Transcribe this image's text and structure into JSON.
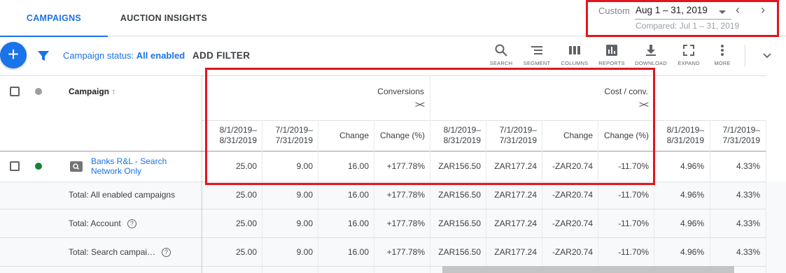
{
  "tabs": [
    {
      "label": "CAMPAIGNS",
      "active": true
    },
    {
      "label": "AUCTION INSIGHTS",
      "active": false
    }
  ],
  "date_range": {
    "custom_label": "Custom",
    "value": "Aug 1 – 31, 2019",
    "compared": "Compared: Jul 1 – 31, 2019",
    "prev_icon": "chevron-left-icon",
    "next_icon": "chevron-right-icon"
  },
  "toolbar": {
    "add_icon": "plus-icon",
    "filter_icon": "filter-icon",
    "status_prefix": "Campaign status:",
    "status_value": "All enabled",
    "add_filter": "ADD FILTER",
    "tools": [
      {
        "label": "SEARCH",
        "icon": "search-icon"
      },
      {
        "label": "SEGMENT",
        "icon": "segment-icon"
      },
      {
        "label": "COLUMNS",
        "icon": "columns-icon"
      },
      {
        "label": "REPORTS",
        "icon": "reports-icon"
      },
      {
        "label": "DOWNLOAD",
        "icon": "download-icon"
      },
      {
        "label": "EXPAND",
        "icon": "expand-icon"
      },
      {
        "label": "MORE",
        "icon": "more-vert-icon"
      }
    ]
  },
  "table": {
    "campaign_header": "Campaign",
    "groups": [
      {
        "label": "Conversions",
        "toggle": "><"
      },
      {
        "label": "Cost / conv.",
        "toggle": "><"
      }
    ],
    "subheaders": [
      "8/1/2019–\n8/31/2019",
      "7/1/2019–\n7/31/2019",
      "Change",
      "Change (%)",
      "8/1/2019–\n8/31/2019",
      "7/1/2019–\n7/31/2019",
      "Change",
      "Change (%)",
      "8/1/2019–\n8/31/2019",
      "7/1/2019–\n7/31/2019"
    ],
    "campaign_row": {
      "name": "Banks R&L - Search Network Only",
      "status_color": "#188038",
      "values": [
        "25.00",
        "9.00",
        "16.00",
        "+177.78%",
        "ZAR156.50",
        "ZAR177.24",
        "-ZAR20.74",
        "-11.70%",
        "4.96%",
        "4.33%"
      ]
    },
    "totals": [
      {
        "label": "Total: All enabled campaigns",
        "help": false,
        "values": [
          "25.00",
          "9.00",
          "16.00",
          "+177.78%",
          "ZAR156.50",
          "ZAR177.24",
          "-ZAR20.74",
          "-11.70%",
          "4.96%",
          "4.33%"
        ]
      },
      {
        "label": "Total: Account",
        "help": true,
        "values": [
          "25.00",
          "9.00",
          "16.00",
          "+177.78%",
          "ZAR156.50",
          "ZAR177.24",
          "-ZAR20.74",
          "-11.70%",
          "4.96%",
          "4.33%"
        ]
      },
      {
        "label": "Total: Search campai…",
        "help": true,
        "values": [
          "25.00",
          "9.00",
          "16.00",
          "+177.78%",
          "ZAR156.50",
          "ZAR177.24",
          "-ZAR20.74",
          "-11.70%",
          "4.96%",
          "4.33%"
        ]
      }
    ]
  },
  "colors": {
    "accent": "#1a73e8",
    "highlight": "#e0161e",
    "enabled_dot": "#188038"
  }
}
